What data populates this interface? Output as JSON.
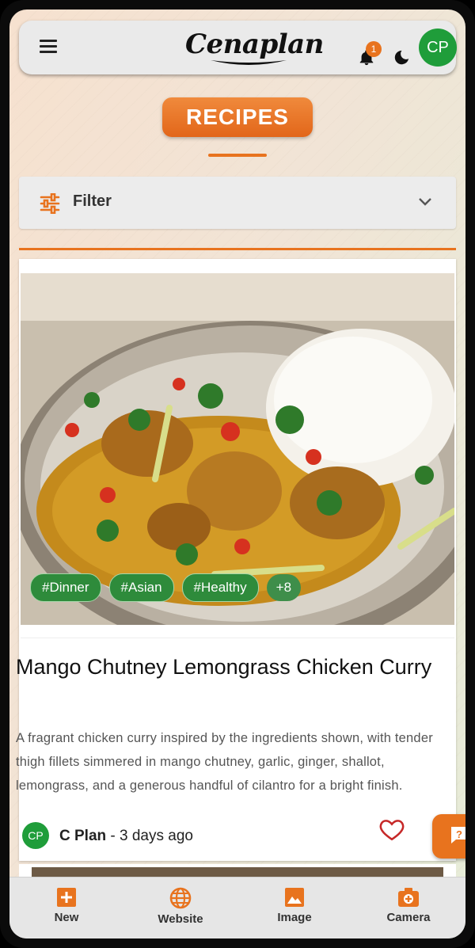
{
  "header": {
    "logo_text": "Cenaplan",
    "notification_count": "1",
    "avatar_initials": "CP"
  },
  "page": {
    "title": "RECIPES",
    "filter_label": "Filter"
  },
  "recipe": {
    "tags": [
      "#Dinner",
      "#Asian",
      "#Healthy"
    ],
    "more_tags": "+8",
    "title": "Mango Chutney Lemongrass Chicken Curry",
    "description": "A fragrant chicken curry inspired by the ingredients shown, with tender thigh fillets simmered in mango chutney, garlic, ginger, shallot, lemongrass, and a generous handful of cilantro for a bright finish.",
    "author_initials": "CP",
    "author_name": "C Plan",
    "posted": " - 3 days ago"
  },
  "bottom_nav": {
    "new_label": "New",
    "website_label": "Website",
    "image_label": "Image",
    "camera_label": "Camera"
  },
  "colors": {
    "accent": "#e8731e",
    "tag_green": "#2e8b3b",
    "avatar_green": "#1f9d3a"
  },
  "icons": [
    "menu-icon",
    "bell-icon",
    "moon-icon",
    "filter-icon",
    "chevron-down-icon",
    "heart-icon",
    "help-icon",
    "add-icon",
    "globe-icon",
    "image-icon",
    "camera-icon"
  ]
}
